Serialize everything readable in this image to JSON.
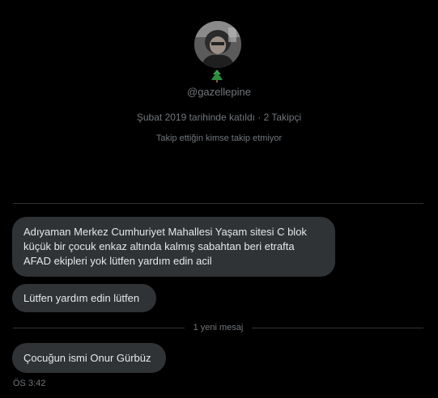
{
  "profile": {
    "username": "@gazellepine",
    "joined": "Şubat 2019 tarihinde katıldı · 2 Takipçi",
    "follow_note": "Takip ettiğin kimse takip etmiyor",
    "badge_icon": "evergreen-tree-icon"
  },
  "messages": [
    {
      "lines": [
        "Adıyaman Merkez Cumhuriyet Mahallesi Yaşam sitesi C blok",
        "küçük bir çocuk enkaz altında kalmış sabahtan beri etrafta",
        "AFAD ekipleri yok lütfen yardım edin acil"
      ]
    },
    {
      "text": "Lütfen yardım edin lütfen"
    },
    {
      "text": "Çocuğun ismi Onur Gürbüz"
    }
  ],
  "new_messages_label": "1 yeni mesaj",
  "timestamp": "ÖS 3:42",
  "colors": {
    "background": "#000000",
    "bubble": "#2f3336",
    "text": "#e7e9ea",
    "muted": "#71767b",
    "divider": "#2f3336"
  }
}
